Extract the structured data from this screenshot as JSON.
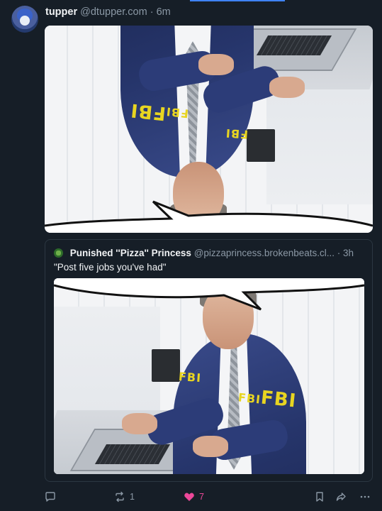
{
  "post": {
    "author_name": "tupper",
    "author_handle": "@dtupper.com",
    "separator": "·",
    "time": "6m"
  },
  "quote": {
    "author_name": "Punished ''Pizza'' Princess",
    "author_handle": "@pizzaprincess.brokenbeats.cl...",
    "separator": "·",
    "time": "3h",
    "text": "\"Post five jobs you've had\""
  },
  "images": {
    "main_label": "FBI",
    "quote_label": "FBI"
  },
  "actions": {
    "reply_icon": "reply-icon",
    "repost_icon": "repost-icon",
    "repost_count": "1",
    "like_icon": "heart-icon",
    "like_count": "7",
    "bookmark_icon": "bookmark-icon",
    "share_icon": "share-icon",
    "more_icon": "more-icon"
  },
  "colors": {
    "background": "#161e27",
    "like": "#ec4899",
    "muted": "#8b98a5"
  }
}
